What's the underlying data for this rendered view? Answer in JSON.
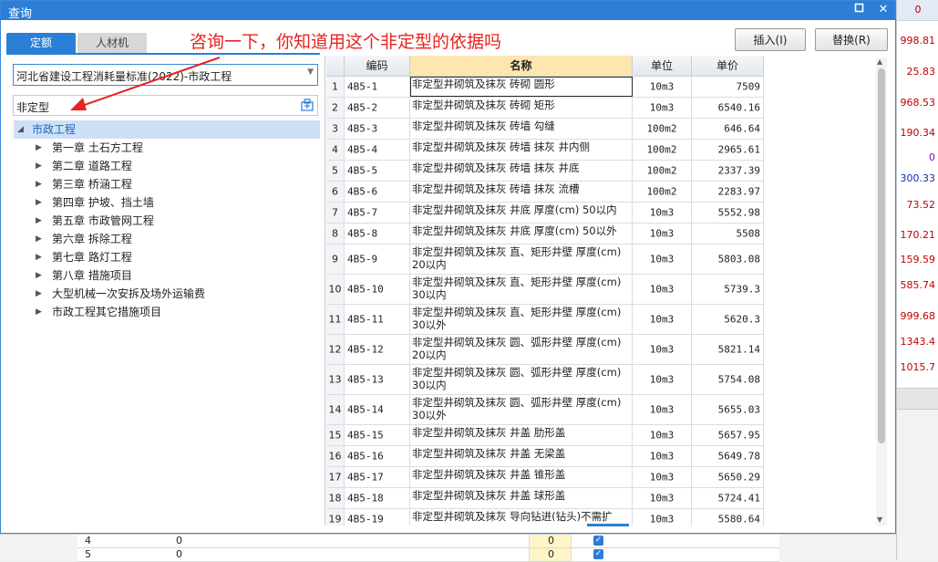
{
  "dialog": {
    "title": "查询",
    "tabs": [
      "定额",
      "人材机"
    ],
    "annotation": "咨询一下，你知道用这个非定型的依据吗",
    "buttons": {
      "insert": "插入(I)",
      "replace": "替换(R)"
    },
    "library_select": "河北省建设工程消耗量标准(2022)-市政工程",
    "search_value": "非定型",
    "tree": {
      "root": "市政工程",
      "children": [
        "第一章 土石方工程",
        "第二章 道路工程",
        "第三章 桥涵工程",
        "第四章 护坡、挡土墙",
        "第五章 市政管网工程",
        "第六章 拆除工程",
        "第七章 路灯工程",
        "第八章 措施项目",
        "大型机械一次安拆及场外运输费",
        "市政工程其它措施项目"
      ]
    },
    "grid": {
      "headers": [
        "编码",
        "名称",
        "单位",
        "单价"
      ],
      "rows": [
        {
          "n": "1",
          "code": "4B5-1",
          "name": "非定型井砌筑及抹灰 砖砌 圆形",
          "unit": "10m3",
          "price": "7509"
        },
        {
          "n": "2",
          "code": "4B5-2",
          "name": "非定型井砌筑及抹灰 砖砌 矩形",
          "unit": "10m3",
          "price": "6540.16"
        },
        {
          "n": "3",
          "code": "4B5-3",
          "name": "非定型井砌筑及抹灰 砖墙 勾缝",
          "unit": "100m2",
          "price": "646.64"
        },
        {
          "n": "4",
          "code": "4B5-4",
          "name": "非定型井砌筑及抹灰 砖墙 抹灰 井内侧",
          "unit": "100m2",
          "price": "2965.61"
        },
        {
          "n": "5",
          "code": "4B5-5",
          "name": "非定型井砌筑及抹灰 砖墙 抹灰 井底",
          "unit": "100m2",
          "price": "2337.39"
        },
        {
          "n": "6",
          "code": "4B5-6",
          "name": "非定型井砌筑及抹灰 砖墙 抹灰 流槽",
          "unit": "100m2",
          "price": "2283.97"
        },
        {
          "n": "7",
          "code": "4B5-7",
          "name": "非定型井砌筑及抹灰 井底 厚度(cm) 50以内",
          "unit": "10m3",
          "price": "5552.98"
        },
        {
          "n": "8",
          "code": "4B5-8",
          "name": "非定型井砌筑及抹灰 井底 厚度(cm) 50以外",
          "unit": "10m3",
          "price": "5508"
        },
        {
          "n": "9",
          "code": "4B5-9",
          "name": "非定型井砌筑及抹灰 直、矩形井壁 厚度(cm) 20以内",
          "unit": "10m3",
          "price": "5803.08"
        },
        {
          "n": "10",
          "code": "4B5-10",
          "name": "非定型井砌筑及抹灰 直、矩形井壁 厚度(cm) 30以内",
          "unit": "10m3",
          "price": "5739.3"
        },
        {
          "n": "11",
          "code": "4B5-11",
          "name": "非定型井砌筑及抹灰 直、矩形井壁 厚度(cm) 30以外",
          "unit": "10m3",
          "price": "5620.3"
        },
        {
          "n": "12",
          "code": "4B5-12",
          "name": "非定型井砌筑及抹灰 圆、弧形井壁 厚度(cm) 20以内",
          "unit": "10m3",
          "price": "5821.14"
        },
        {
          "n": "13",
          "code": "4B5-13",
          "name": "非定型井砌筑及抹灰 圆、弧形井壁 厚度(cm) 30以内",
          "unit": "10m3",
          "price": "5754.08"
        },
        {
          "n": "14",
          "code": "4B5-14",
          "name": "非定型井砌筑及抹灰 圆、弧形井壁 厚度(cm) 30以外",
          "unit": "10m3",
          "price": "5655.03"
        },
        {
          "n": "15",
          "code": "4B5-15",
          "name": "非定型井砌筑及抹灰 井盖 肋形盖",
          "unit": "10m3",
          "price": "5657.95"
        },
        {
          "n": "16",
          "code": "4B5-16",
          "name": "非定型井砌筑及抹灰 井盖 无梁盖",
          "unit": "10m3",
          "price": "5649.78"
        },
        {
          "n": "17",
          "code": "4B5-17",
          "name": "非定型井砌筑及抹灰 井盖 锥形盖",
          "unit": "10m3",
          "price": "5650.29"
        },
        {
          "n": "18",
          "code": "4B5-18",
          "name": "非定型井砌筑及抹灰 井盖 球形盖",
          "unit": "10m3",
          "price": "5724.41"
        },
        {
          "n": "19",
          "code": "4B5-19",
          "name": "非定型井砌筑及抹灰 导向钻进(钻头)不需扩",
          "unit": "10m3",
          "price": "5580.64"
        }
      ]
    }
  },
  "background": {
    "right_header": "0",
    "right_values": [
      {
        "v": "998.81",
        "color": "#c00000"
      },
      {
        "v": "25.83",
        "color": "#c00000"
      },
      {
        "v": "968.53",
        "color": "#c00000"
      },
      {
        "v": "190.34",
        "color": "#c00000"
      },
      {
        "v": "0",
        "color": "#8a00c8"
      },
      {
        "v": "300.33",
        "color": "#1030c0"
      },
      {
        "v": "73.52",
        "color": "#c00000"
      },
      {
        "v": "170.21",
        "color": "#c00000"
      },
      {
        "v": "159.59",
        "color": "#c00000"
      },
      {
        "v": "585.74",
        "color": "#c00000"
      },
      {
        "v": "999.68",
        "color": "#c00000"
      },
      {
        "v": "1343.4",
        "color": "#c00000"
      },
      {
        "v": "1015.7",
        "color": "#c00000"
      }
    ],
    "bottom_rows": [
      {
        "num": "4",
        "val": "0",
        "yv": "0"
      },
      {
        "num": "5",
        "val": "0",
        "yv": "0"
      }
    ]
  },
  "colors": {
    "accent": "#2b7fd6",
    "annotation": "#e8231f",
    "header_highlight": "#fde6b0"
  }
}
